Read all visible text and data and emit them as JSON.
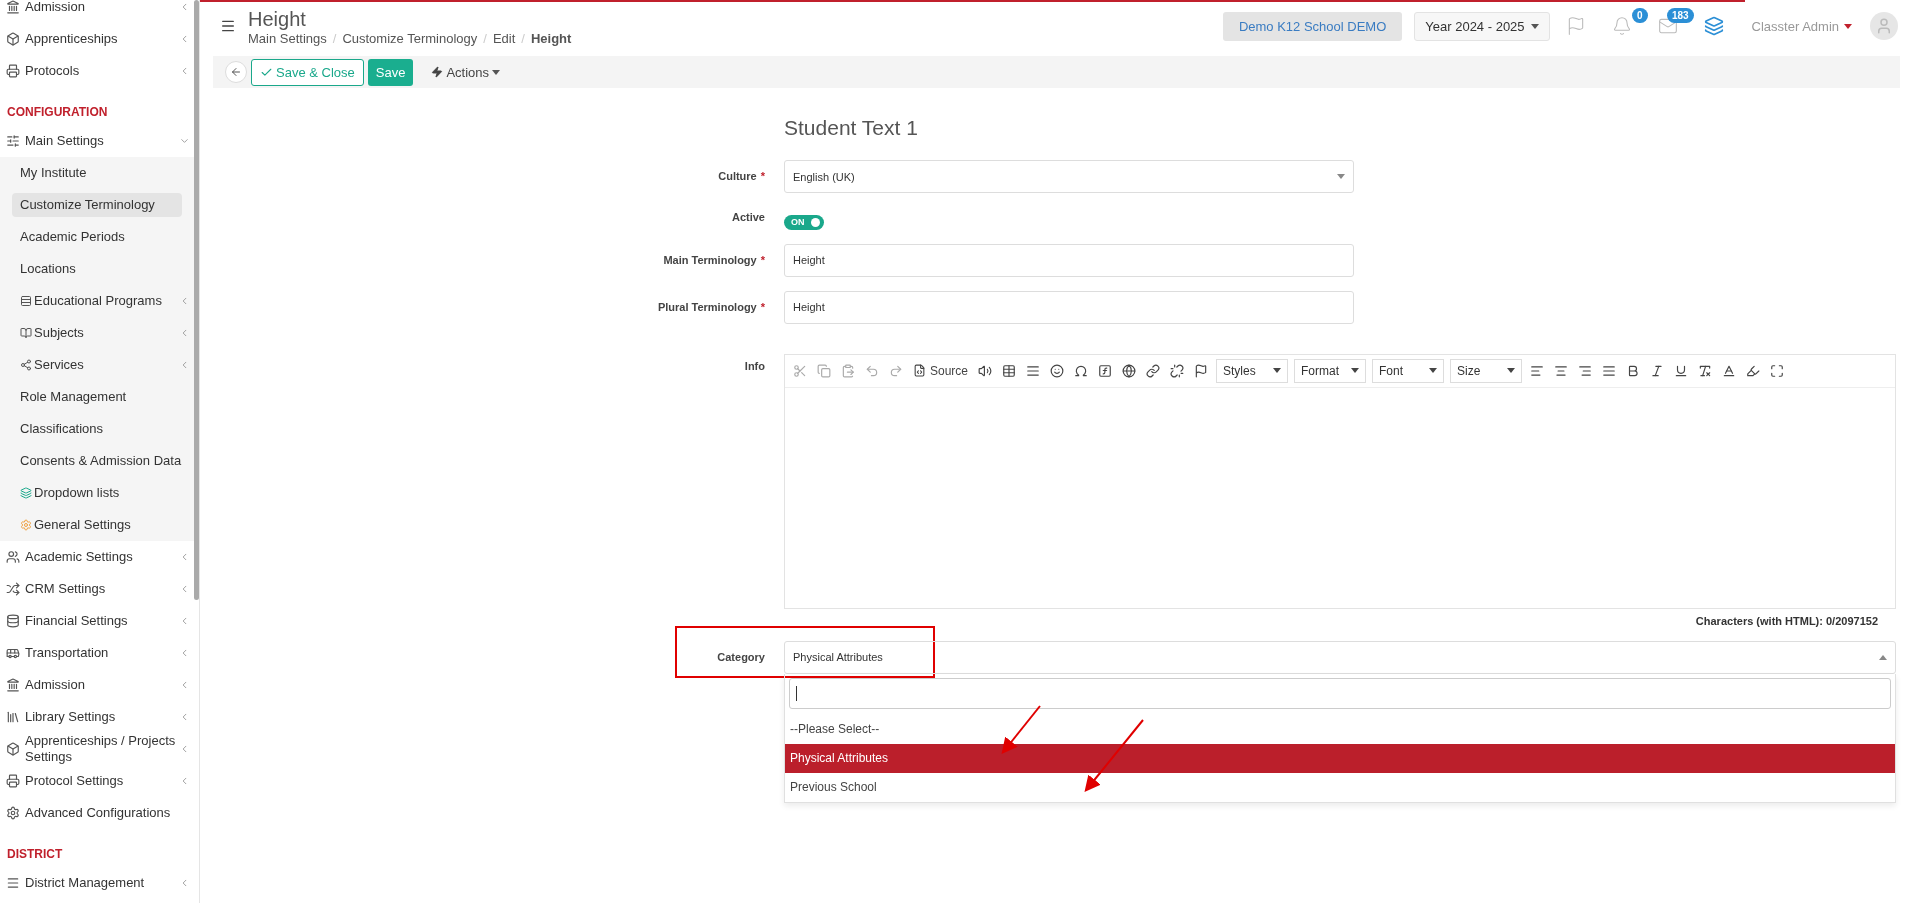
{
  "sidebar": {
    "items": [
      {
        "kind": "item",
        "label": "Admission",
        "expanded": false
      },
      {
        "kind": "item",
        "label": "Apprenticeships",
        "expanded": false
      },
      {
        "kind": "item",
        "label": "Protocols",
        "expanded": false
      },
      {
        "kind": "heading",
        "label": "CONFIGURATION"
      },
      {
        "kind": "item",
        "label": "Main Settings",
        "expanded": true,
        "children": [
          {
            "label": "My Institute",
            "selected": false
          },
          {
            "label": "Customize Terminology",
            "selected": true
          },
          {
            "label": "Academic Periods",
            "selected": false
          },
          {
            "label": "Locations",
            "selected": false
          },
          {
            "label": "Educational Programs",
            "selected": false,
            "expanded": false
          },
          {
            "label": "Subjects",
            "selected": false,
            "expanded": false
          },
          {
            "label": "Services",
            "selected": false,
            "expanded": false
          },
          {
            "label": "Role Management",
            "selected": false
          },
          {
            "label": "Classifications",
            "selected": false
          },
          {
            "label": "Consents & Admission Data",
            "selected": false
          },
          {
            "label": "Dropdown lists",
            "selected": false
          },
          {
            "label": "General Settings",
            "selected": false
          }
        ]
      },
      {
        "kind": "item",
        "label": "Academic Settings",
        "expanded": false
      },
      {
        "kind": "item",
        "label": "CRM Settings",
        "expanded": false
      },
      {
        "kind": "item",
        "label": "Financial Settings",
        "expanded": false
      },
      {
        "kind": "item",
        "label": "Transportation",
        "expanded": false
      },
      {
        "kind": "item",
        "label": "Admission",
        "expanded": false
      },
      {
        "kind": "item",
        "label": "Library Settings",
        "expanded": false
      },
      {
        "kind": "item",
        "label": "Apprenticeships / Projects Settings",
        "expanded": false
      },
      {
        "kind": "item",
        "label": "Protocol Settings",
        "expanded": false
      },
      {
        "kind": "item",
        "label": "Advanced Configurations"
      },
      {
        "kind": "heading",
        "label": "DISTRICT"
      },
      {
        "kind": "item",
        "label": "District Management",
        "expanded": false
      }
    ]
  },
  "header": {
    "title": "Height",
    "separator": "/",
    "breadcrumb": [
      "Main Settings",
      "Customize Terminology",
      "Edit",
      "Height"
    ],
    "school": "Demo K12 School DEMO",
    "year": "Year 2024 - 2025",
    "notifications": "0",
    "messages": "183",
    "user": "Classter Admin"
  },
  "toolbar": {
    "save_close": "Save & Close",
    "save": "Save",
    "actions": "Actions"
  },
  "form": {
    "title": "Student Text 1",
    "required_mark": "*",
    "fields": [
      {
        "kind": "select",
        "label": "Culture",
        "required": true,
        "value": "English (UK)"
      },
      {
        "kind": "toggle",
        "label": "Active",
        "required": false,
        "on": true,
        "text": "ON"
      },
      {
        "kind": "text",
        "label": "Main Terminology",
        "required": true,
        "value": "Height"
      },
      {
        "kind": "text",
        "label": "Plural Terminology",
        "required": true,
        "value": "Height"
      },
      {
        "kind": "editor",
        "label": "Info",
        "required": false,
        "source": "Source",
        "combos": [
          "Styles",
          "Format",
          "Font",
          "Size"
        ],
        "counter": "Characters (with HTML): 0/2097152"
      },
      {
        "kind": "dropdown",
        "label": "Category",
        "required": false,
        "value": "Physical Attributes",
        "expanded": true,
        "options": [
          {
            "label": "--Please Select--",
            "selected": false
          },
          {
            "label": "Physical Attributes",
            "selected": true
          },
          {
            "label": "Previous School",
            "selected": false
          }
        ]
      }
    ]
  }
}
